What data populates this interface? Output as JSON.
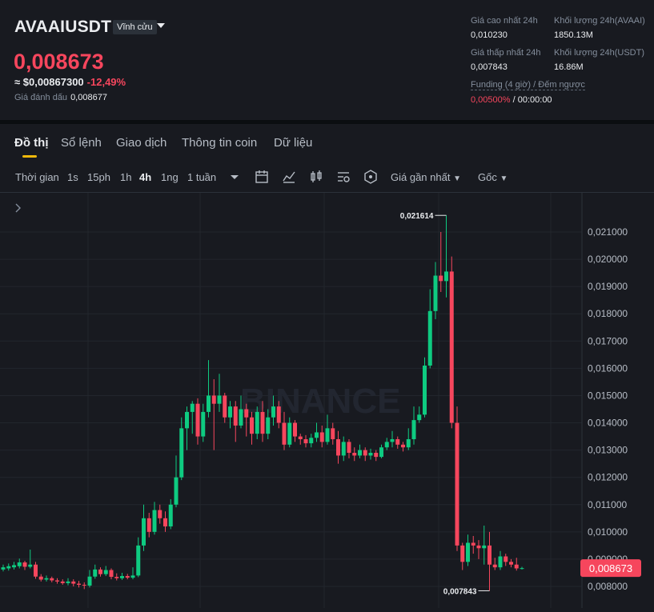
{
  "header": {
    "symbol": "AVAAIUSDT",
    "contract_type": "Vĩnh cửu",
    "last_price": "0,008673",
    "usd_price": "≈ $0,00867300",
    "change_pct": "-12,49%",
    "mark_label": "Giá đánh dấu",
    "mark_value": "0,008677",
    "high_label": "Giá cao nhất 24h",
    "high_value": "0,010230",
    "vol_base_label": "Khối lượng 24h(AVAAI)",
    "vol_base_value": "1850.13M",
    "low_label": "Giá thấp nhất 24h",
    "low_value": "0,007843",
    "vol_quote_label": "Khối lượng 24h(USDT)",
    "vol_quote_value": "16.86M",
    "funding_label": "Funding (4 giờ) / Đếm ngược",
    "funding_rate": "0,00500%",
    "funding_sep": "/",
    "countdown": "00:00:00"
  },
  "tabs": [
    "Đồ thị",
    "Sổ lệnh",
    "Giao dịch",
    "Thông tin coin",
    "Dữ liệu"
  ],
  "toolbar": {
    "time_label": "Thời gian",
    "intervals": [
      "1s",
      "15ph",
      "1h",
      "4h",
      "1ng",
      "1 tuần"
    ],
    "active_interval": "4h",
    "price_source": "Giá gần nhất",
    "view_mode": "Gốc",
    "icons": [
      "chevron-down-icon",
      "calendar-icon",
      "line-chart-icon",
      "candlestick-icon",
      "settings-chart-icon",
      "depth-icon"
    ]
  },
  "colors": {
    "up": "#0ecb81",
    "down": "#f6465d",
    "accent": "#f0b90b",
    "bg": "#181a20"
  },
  "chart_data": {
    "type": "candlestick",
    "yaxis_ticks": [
      "0,021000",
      "0,020000",
      "0,019000",
      "0,018000",
      "0,017000",
      "0,016000",
      "0,015000",
      "0,014000",
      "0,013000",
      "0,012000",
      "0,011000",
      "0,010000",
      "0,009000",
      "0,008000"
    ],
    "ylim": [
      0.0077,
      0.022
    ],
    "high_marker": "0,021614",
    "low_marker": "0,007843",
    "last_price_label": "0,008673",
    "watermark": "BINANCE",
    "candles": [
      [
        0.00862,
        0.0087,
        0.0088,
        0.00855
      ],
      [
        0.00866,
        0.00874,
        0.00884,
        0.00858
      ],
      [
        0.0087,
        0.00878,
        0.0089,
        0.00862
      ],
      [
        0.00874,
        0.00888,
        0.00902,
        0.00866
      ],
      [
        0.00888,
        0.00872,
        0.00894,
        0.0086
      ],
      [
        0.00872,
        0.0088,
        0.00935,
        0.00866
      ],
      [
        0.0088,
        0.00836,
        0.0089,
        0.00828
      ],
      [
        0.00836,
        0.00825,
        0.00845,
        0.00818
      ],
      [
        0.00825,
        0.0083,
        0.0084,
        0.00818
      ],
      [
        0.0083,
        0.00822,
        0.00836,
        0.00815
      ],
      [
        0.00822,
        0.00818,
        0.0083,
        0.0081
      ],
      [
        0.00818,
        0.00812,
        0.00826,
        0.00806
      ],
      [
        0.00812,
        0.00818,
        0.0083,
        0.00804
      ],
      [
        0.00818,
        0.0081,
        0.00826,
        0.008
      ],
      [
        0.0081,
        0.00806,
        0.0082,
        0.00796
      ],
      [
        0.00806,
        0.00803,
        0.00815,
        0.0079
      ],
      [
        0.00803,
        0.00836,
        0.0086,
        0.00796
      ],
      [
        0.00836,
        0.00862,
        0.0088,
        0.00828
      ],
      [
        0.00862,
        0.00845,
        0.0087,
        0.00836
      ],
      [
        0.00845,
        0.0086,
        0.00875,
        0.00838
      ],
      [
        0.0086,
        0.00835,
        0.00866,
        0.00826
      ],
      [
        0.00835,
        0.0083,
        0.00848,
        0.00822
      ],
      [
        0.0083,
        0.00838,
        0.0085,
        0.00824
      ],
      [
        0.00838,
        0.00832,
        0.00846,
        0.00826
      ],
      [
        0.00832,
        0.0084,
        0.0087,
        0.00826
      ],
      [
        0.0084,
        0.0095,
        0.0098,
        0.00834
      ],
      [
        0.0095,
        0.0105,
        0.011,
        0.0093
      ],
      [
        0.0105,
        0.01,
        0.0107,
        0.0098
      ],
      [
        0.01,
        0.0108,
        0.0111,
        0.0099
      ],
      [
        0.0108,
        0.0105,
        0.011,
        0.0103
      ],
      [
        0.0105,
        0.0102,
        0.01075,
        0.01
      ],
      [
        0.0102,
        0.011,
        0.0112,
        0.0101
      ],
      [
        0.011,
        0.012,
        0.0128,
        0.0109
      ],
      [
        0.012,
        0.0138,
        0.0142,
        0.0119
      ],
      [
        0.0138,
        0.0144,
        0.0146,
        0.013
      ],
      [
        0.0144,
        0.0147,
        0.0148,
        0.0136
      ],
      [
        0.0147,
        0.0135,
        0.0149,
        0.0132
      ],
      [
        0.0135,
        0.0144,
        0.0147,
        0.0133
      ],
      [
        0.0144,
        0.015,
        0.0163,
        0.0142
      ],
      [
        0.015,
        0.0147,
        0.0156,
        0.013
      ],
      [
        0.0147,
        0.015,
        0.0158,
        0.0144
      ],
      [
        0.015,
        0.0142,
        0.0151,
        0.014
      ],
      [
        0.0142,
        0.0146,
        0.0148,
        0.0138
      ],
      [
        0.0146,
        0.0139,
        0.0148,
        0.0133
      ],
      [
        0.0139,
        0.0145,
        0.015,
        0.0138
      ],
      [
        0.0145,
        0.0142,
        0.0147,
        0.0135
      ],
      [
        0.0142,
        0.0136,
        0.0144,
        0.0132
      ],
      [
        0.0136,
        0.0144,
        0.0146,
        0.0134
      ],
      [
        0.0144,
        0.0136,
        0.0148,
        0.0133
      ],
      [
        0.0136,
        0.0142,
        0.0145,
        0.0134
      ],
      [
        0.0142,
        0.0146,
        0.015,
        0.0139
      ],
      [
        0.0146,
        0.014,
        0.0148,
        0.0138
      ],
      [
        0.014,
        0.0132,
        0.0144,
        0.013
      ],
      [
        0.0132,
        0.014,
        0.0142,
        0.0131
      ],
      [
        0.014,
        0.0135,
        0.0141,
        0.0133
      ],
      [
        0.0135,
        0.0134,
        0.0136,
        0.0132
      ],
      [
        0.0134,
        0.01325,
        0.01355,
        0.0131
      ],
      [
        0.01325,
        0.01345,
        0.0136,
        0.0131
      ],
      [
        0.01345,
        0.01365,
        0.014,
        0.0133
      ],
      [
        0.01365,
        0.0133,
        0.0139,
        0.0131
      ],
      [
        0.0133,
        0.0138,
        0.0143,
        0.0132
      ],
      [
        0.0138,
        0.0134,
        0.014,
        0.0132
      ],
      [
        0.0134,
        0.0128,
        0.0137,
        0.0125
      ],
      [
        0.0128,
        0.0133,
        0.0135,
        0.0126
      ],
      [
        0.0133,
        0.0129,
        0.0134,
        0.0127
      ],
      [
        0.0129,
        0.0128,
        0.0131,
        0.0126
      ],
      [
        0.0128,
        0.013,
        0.0132,
        0.0127
      ],
      [
        0.013,
        0.0128,
        0.0131,
        0.0126
      ],
      [
        0.0128,
        0.0129,
        0.01305,
        0.01265
      ],
      [
        0.0129,
        0.01275,
        0.013,
        0.0126
      ],
      [
        0.01275,
        0.0131,
        0.0132,
        0.0127
      ],
      [
        0.0131,
        0.0133,
        0.01345,
        0.013
      ],
      [
        0.0133,
        0.0134,
        0.0137,
        0.0131
      ],
      [
        0.0134,
        0.0132,
        0.0135,
        0.01305
      ],
      [
        0.0132,
        0.0131,
        0.0133,
        0.01295
      ],
      [
        0.0131,
        0.0134,
        0.0138,
        0.013
      ],
      [
        0.0134,
        0.0141,
        0.0146,
        0.0132
      ],
      [
        0.0141,
        0.0143,
        0.0146,
        0.014
      ],
      [
        0.0143,
        0.0161,
        0.0164,
        0.0142
      ],
      [
        0.0161,
        0.0181,
        0.0189,
        0.016
      ],
      [
        0.0181,
        0.0194,
        0.0199,
        0.0178
      ],
      [
        0.0194,
        0.0192,
        0.021,
        0.0188
      ],
      [
        0.0192,
        0.01955,
        0.02161,
        0.0186
      ],
      [
        0.01955,
        0.014,
        0.0201,
        0.0138
      ],
      [
        0.014,
        0.0095,
        0.0146,
        0.0093
      ],
      [
        0.0095,
        0.0089,
        0.0096,
        0.0086
      ],
      [
        0.0089,
        0.0096,
        0.0099,
        0.00875
      ],
      [
        0.0096,
        0.0095,
        0.00985,
        0.0092
      ],
      [
        0.0095,
        0.0094,
        0.0097,
        0.009
      ],
      [
        0.0094,
        0.0095,
        0.01023,
        0.0088
      ],
      [
        0.0095,
        0.0088,
        0.01,
        0.00784
      ],
      [
        0.0088,
        0.0087,
        0.00905,
        0.0086
      ],
      [
        0.0087,
        0.0091,
        0.0093,
        0.0086
      ],
      [
        0.0091,
        0.0089,
        0.0092,
        0.00875
      ],
      [
        0.0089,
        0.0088,
        0.009,
        0.0087
      ],
      [
        0.0088,
        0.00866,
        0.00905,
        0.00858
      ],
      [
        0.00866,
        0.00867,
        0.00872,
        0.00862
      ]
    ]
  }
}
